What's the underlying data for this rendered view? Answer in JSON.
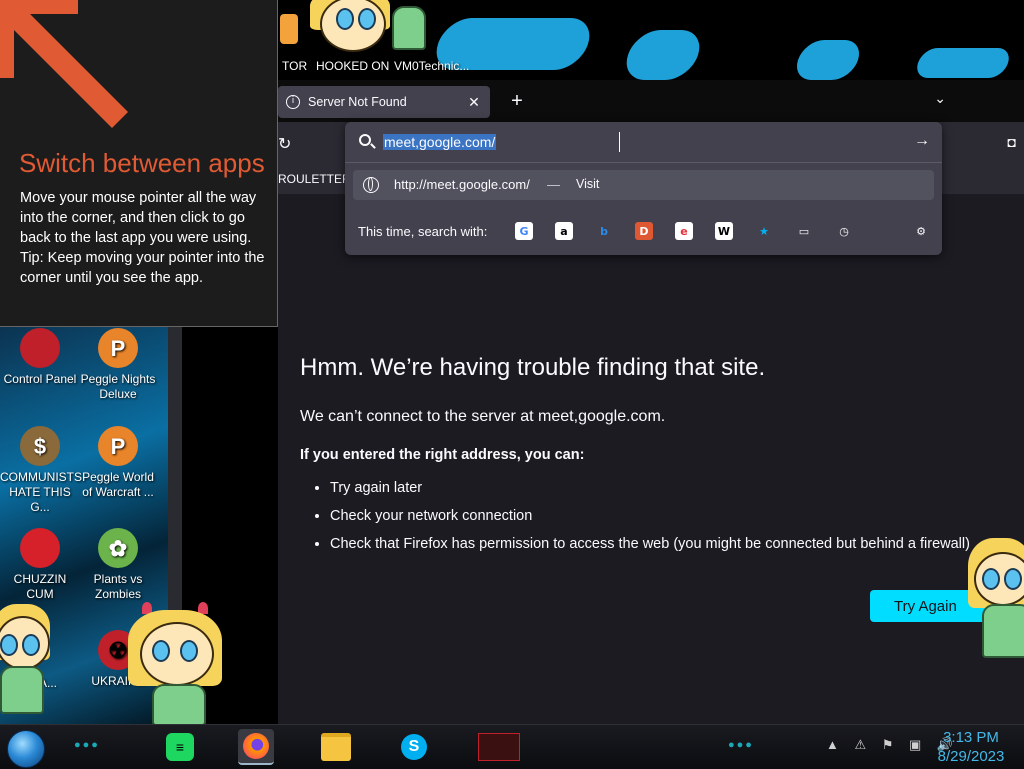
{
  "desktop": {
    "top_icons": [
      {
        "label": "TOR"
      },
      {
        "label": "HOOKED ON"
      },
      {
        "label": "VM0Technic..."
      }
    ],
    "icons": [
      {
        "label": "Control Panel",
        "glyph": "♥",
        "color": "#c0202a"
      },
      {
        "label": "Peggle Nights Deluxe",
        "glyph": "P",
        "color": "#e8842a"
      },
      {
        "label": "COMMUNISTS HATE THIS G...",
        "glyph": "$",
        "color": "#8a6a3a"
      },
      {
        "label": "Peggle World of Warcraft ...",
        "glyph": "P",
        "color": "#e8842a"
      },
      {
        "label": "CHUZZIN CUM",
        "glyph": "●",
        "color": "#d6202a"
      },
      {
        "label": "Plants vs Zombies",
        "glyph": "✿",
        "color": "#6bb34a"
      },
      {
        "label": "ad A...",
        "glyph": "",
        "color": "#333"
      },
      {
        "label": "UKRAINE",
        "glyph": "☢",
        "color": "#c0202a"
      }
    ]
  },
  "switch_tip": {
    "title": "Switch between apps",
    "body_lines": [
      "Move your mouse pointer all the way into the corner, and then click to go back to the last app you were using.",
      "Tip: Keep moving your pointer into the corner until you see the app."
    ],
    "accent": "#e05a33"
  },
  "browser": {
    "tab_title": "Server Not Found",
    "new_tab": "+",
    "tab_list_icon": "chevron-down-icon",
    "bookmark": "ROULETTER",
    "url_bar": {
      "value": "meet,google.com/",
      "suggestion_url": "http://meet.google.com/",
      "suggestion_sep": "—",
      "suggestion_action": "Visit",
      "search_with_label": "This time, search with:"
    },
    "engines": [
      {
        "name": "google-icon",
        "glyph": "G",
        "bg": "#ffffff",
        "fg": "#4285f4"
      },
      {
        "name": "amazon-icon",
        "glyph": "a",
        "bg": "#ffffff",
        "fg": "#000000"
      },
      {
        "name": "bing-icon",
        "glyph": "b",
        "bg": "transparent",
        "fg": "#2b8be8"
      },
      {
        "name": "duckduckgo-icon",
        "glyph": "D",
        "bg": "#de5833",
        "fg": "#ffffff"
      },
      {
        "name": "ebay-icon",
        "glyph": "e",
        "bg": "#ffffff",
        "fg": "#e53238"
      },
      {
        "name": "wikipedia-icon",
        "glyph": "W",
        "bg": "#ffffff",
        "fg": "#000000"
      },
      {
        "name": "bookmarks-star-icon",
        "glyph": "★",
        "bg": "transparent",
        "fg": "#00b3f4"
      },
      {
        "name": "tabs-icon",
        "glyph": "▭",
        "bg": "transparent",
        "fg": "#fbfbfe"
      },
      {
        "name": "history-icon",
        "glyph": "◷",
        "bg": "transparent",
        "fg": "#fbfbfe"
      },
      {
        "name": "settings-gear-icon",
        "glyph": "⚙",
        "bg": "transparent",
        "fg": "#fbfbfe"
      }
    ],
    "error": {
      "title": "Hmm. We’re having trouble finding that site.",
      "subtitle": "We can’t connect to the server at meet,google.com.",
      "advice": "If you entered the right address, you can:",
      "items": [
        "Try again later",
        "Check your network connection",
        "Check that Firefox has permission to access the web (you might be connected but behind a firewall)"
      ],
      "button": "Try Again"
    }
  },
  "taskbar": {
    "clock_time": "3:13 PM",
    "clock_date": "8/29/2023",
    "accent": "#43b8e8"
  }
}
